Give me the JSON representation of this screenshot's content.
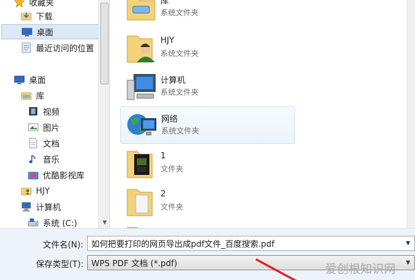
{
  "sidebar": {
    "favorites": [
      {
        "label": "收藏夹",
        "icon": "star-icon"
      },
      {
        "label": "下载",
        "icon": "downloads-folder-icon"
      },
      {
        "label": "桌面",
        "icon": "desktop-icon",
        "selected": true
      },
      {
        "label": "最近访问的位置",
        "icon": "recent-places-icon"
      }
    ],
    "tree": [
      {
        "label": "桌面",
        "icon": "desktop-icon"
      },
      {
        "label": "库",
        "icon": "library-icon"
      },
      {
        "label": "视频",
        "icon": "video-icon"
      },
      {
        "label": "图片",
        "icon": "pictures-icon"
      },
      {
        "label": "文档",
        "icon": "documents-icon"
      },
      {
        "label": "音乐",
        "icon": "music-icon"
      },
      {
        "label": "优酷影视库",
        "icon": "youku-library-icon"
      },
      {
        "label": "HJY",
        "icon": "user-folder-icon"
      },
      {
        "label": "计算机",
        "icon": "computer-icon"
      },
      {
        "label": "系统 (C:)",
        "icon": "drive-icon"
      }
    ]
  },
  "main": {
    "items": [
      {
        "name": "库",
        "type": "系统文件夹"
      },
      {
        "name": "HJY",
        "type": "系统文件夹"
      },
      {
        "name": "计算机",
        "type": "系统文件夹"
      },
      {
        "name": "网络",
        "type": "系统文件夹"
      },
      {
        "name": "1",
        "type": "文件夹"
      },
      {
        "name": "2",
        "type": "文件夹"
      }
    ]
  },
  "footer": {
    "filename_label": "文件名(N):",
    "filename_value": "如何把要打印的网页导出成pdf文件_百度搜索.pdf",
    "filetype_label": "保存类型(T):",
    "filetype_value": "WPS PDF 文档 (*.pdf)"
  },
  "watermark": "爱创根知识网"
}
